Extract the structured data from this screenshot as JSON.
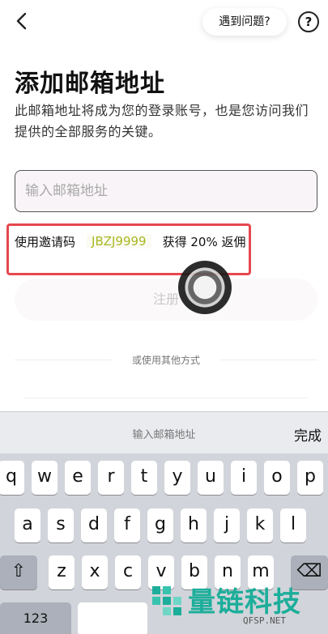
{
  "header": {
    "back_glyph": "<",
    "help_label": "遇到问题?",
    "help_icon_glyph": "?"
  },
  "title": "添加邮箱地址",
  "description": "此邮箱地址将成为您的登录账号，也是您访问我们提供的全部服务的关键。",
  "email_input": {
    "placeholder": "输入邮箱地址",
    "value": ""
  },
  "invite": {
    "prefix": "使用邀请码",
    "code": "JBZJ9999",
    "suffix": "获得 20% 返佣",
    "highlight_color": "#e6484f",
    "code_color": "#a8b820"
  },
  "register_label": "注册",
  "divider_label": "或使用其他方式",
  "keyboard": {
    "placeholder": "输入邮箱地址",
    "done_label": "完成",
    "row1": [
      "q",
      "w",
      "e",
      "r",
      "t",
      "y",
      "u",
      "i",
      "o",
      "p"
    ],
    "row2": [
      "a",
      "s",
      "d",
      "f",
      "g",
      "h",
      "j",
      "k",
      "l"
    ],
    "row3": [
      "z",
      "x",
      "c",
      "v",
      "b",
      "n",
      "m"
    ],
    "numbers_label": "123",
    "shift_glyph": "⇧",
    "delete_glyph": "⌫"
  },
  "watermark": {
    "text": "量链科技",
    "url": "QFSP.NET",
    "color": "#1cae9a"
  }
}
